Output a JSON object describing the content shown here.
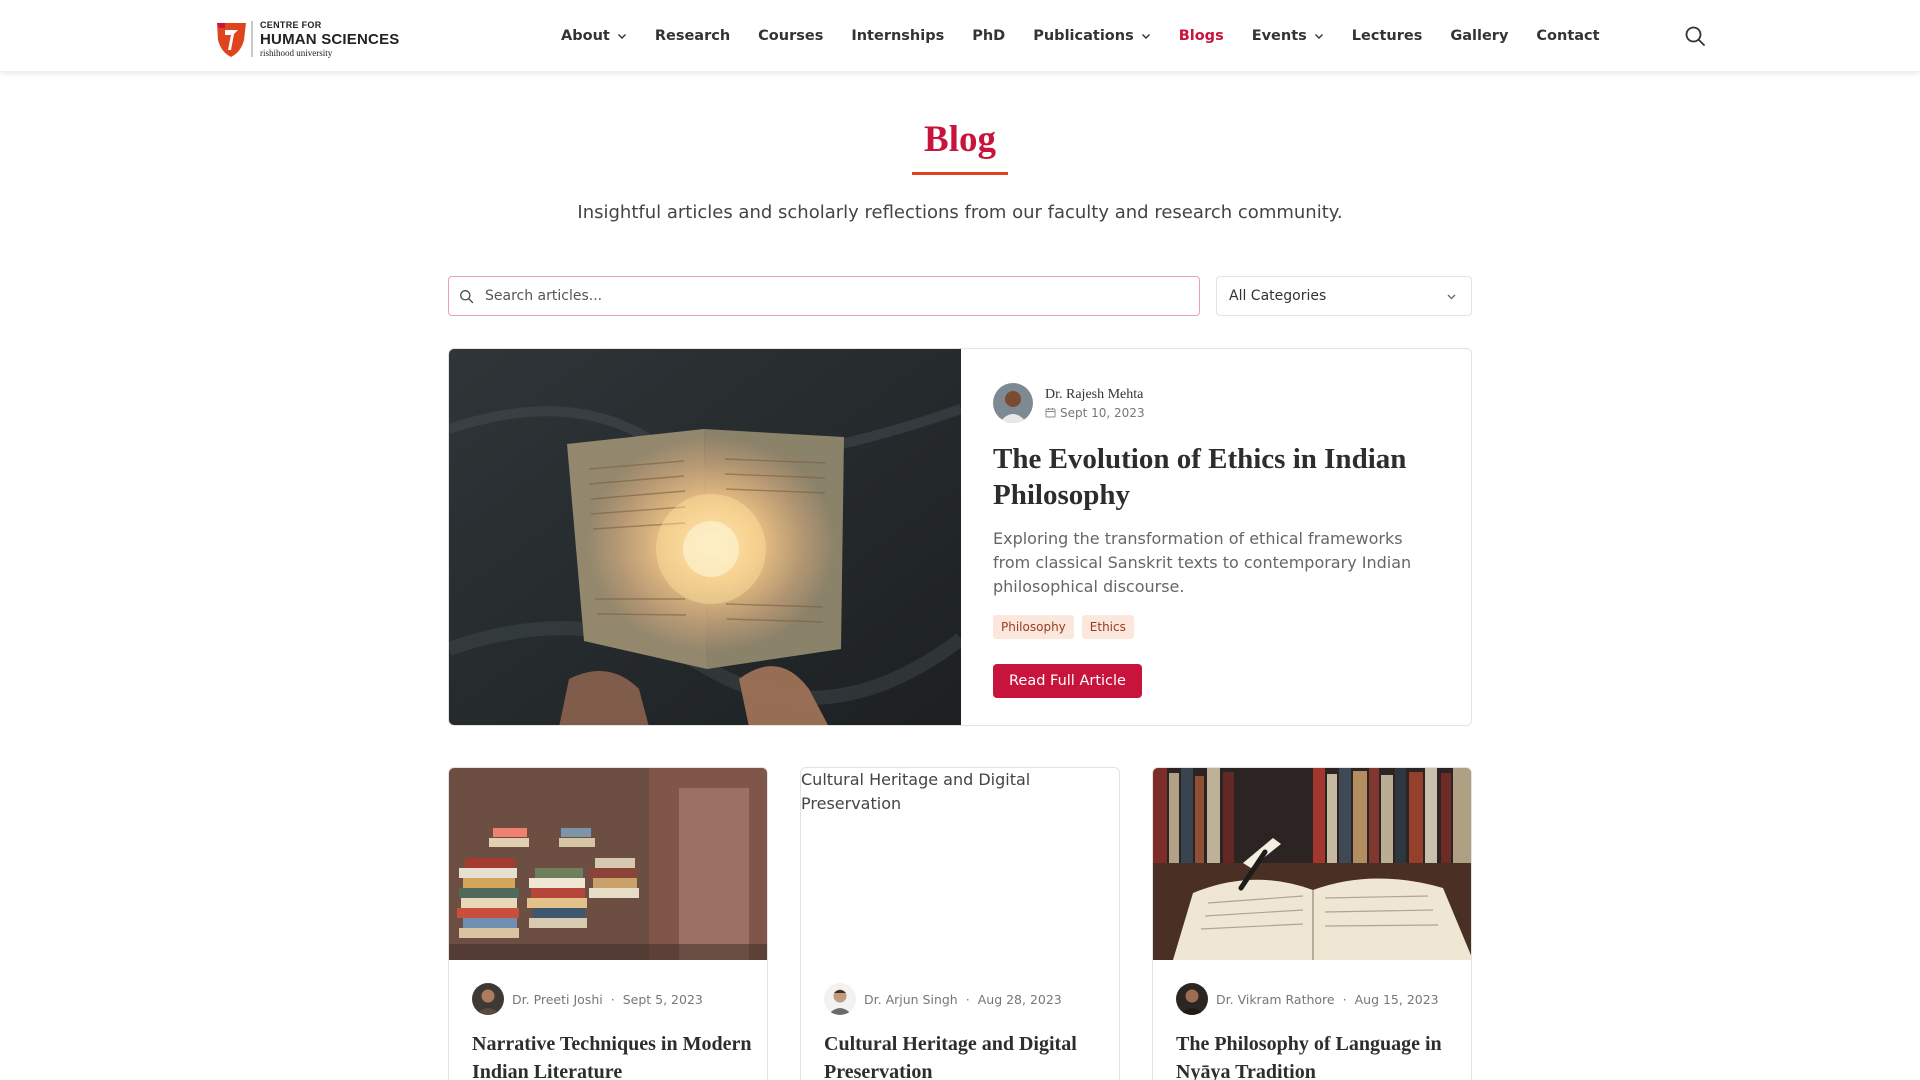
{
  "header": {
    "logo": {
      "line1": "CENTRE FOR",
      "line2": "HUMAN SCIENCES",
      "line3": "rishihood university"
    },
    "nav": [
      {
        "label": "About",
        "dropdown": true,
        "active": false
      },
      {
        "label": "Research",
        "dropdown": false,
        "active": false
      },
      {
        "label": "Courses",
        "dropdown": false,
        "active": false
      },
      {
        "label": "Internships",
        "dropdown": false,
        "active": false
      },
      {
        "label": "PhD",
        "dropdown": false,
        "active": false
      },
      {
        "label": "Publications",
        "dropdown": true,
        "active": false
      },
      {
        "label": "Blogs",
        "dropdown": false,
        "active": true
      },
      {
        "label": "Events",
        "dropdown": true,
        "active": false
      },
      {
        "label": "Lectures",
        "dropdown": false,
        "active": false
      },
      {
        "label": "Gallery",
        "dropdown": false,
        "active": false
      },
      {
        "label": "Contact",
        "dropdown": false,
        "active": false
      }
    ],
    "search_icon": "search-icon"
  },
  "hero": {
    "title": "Blog",
    "subtitle": "Insightful articles and scholarly reflections from our faculty and research community."
  },
  "filters": {
    "search_placeholder": "Search articles...",
    "category_selected": "All Categories"
  },
  "featured": {
    "author": "Dr. Rajesh Mehta",
    "date": "Sept 10, 2023",
    "title": "The Evolution of Ethics in Indian Philosophy",
    "excerpt": "Exploring the transformation of ethical frameworks from classical Sanskrit texts to contemporary Indian philosophical discourse.",
    "tags": [
      "Philosophy",
      "Ethics"
    ],
    "cta": "Read Full Article"
  },
  "cards": [
    {
      "author": "Dr. Preeti Joshi",
      "date": "Sept 5, 2023",
      "title": "Narrative Techniques in Modern Indian Literature",
      "image_alt": ""
    },
    {
      "author": "Dr. Arjun Singh",
      "date": "Aug 28, 2023",
      "title": "Cultural Heritage and Digital Preservation",
      "image_alt": "Cultural Heritage and Digital Preservation"
    },
    {
      "author": "Dr. Vikram Rathore",
      "date": "Aug 15, 2023",
      "title": "The Philosophy of Language in Nyāya Tradition",
      "image_alt": ""
    }
  ],
  "colors": {
    "accent": "#c8143c",
    "underline": "#e0441f",
    "tag_bg": "#fbe7dc",
    "tag_text": "#9a3b22"
  },
  "separator": "·"
}
